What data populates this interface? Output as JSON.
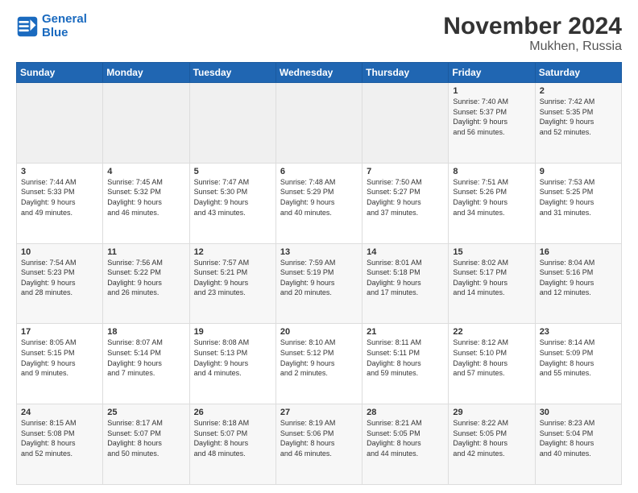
{
  "logo": {
    "line1": "General",
    "line2": "Blue"
  },
  "title": "November 2024",
  "subtitle": "Mukhen, Russia",
  "days_header": [
    "Sunday",
    "Monday",
    "Tuesday",
    "Wednesday",
    "Thursday",
    "Friday",
    "Saturday"
  ],
  "weeks": [
    [
      {
        "num": "",
        "info": ""
      },
      {
        "num": "",
        "info": ""
      },
      {
        "num": "",
        "info": ""
      },
      {
        "num": "",
        "info": ""
      },
      {
        "num": "",
        "info": ""
      },
      {
        "num": "1",
        "info": "Sunrise: 7:40 AM\nSunset: 5:37 PM\nDaylight: 9 hours\nand 56 minutes."
      },
      {
        "num": "2",
        "info": "Sunrise: 7:42 AM\nSunset: 5:35 PM\nDaylight: 9 hours\nand 52 minutes."
      }
    ],
    [
      {
        "num": "3",
        "info": "Sunrise: 7:44 AM\nSunset: 5:33 PM\nDaylight: 9 hours\nand 49 minutes."
      },
      {
        "num": "4",
        "info": "Sunrise: 7:45 AM\nSunset: 5:32 PM\nDaylight: 9 hours\nand 46 minutes."
      },
      {
        "num": "5",
        "info": "Sunrise: 7:47 AM\nSunset: 5:30 PM\nDaylight: 9 hours\nand 43 minutes."
      },
      {
        "num": "6",
        "info": "Sunrise: 7:48 AM\nSunset: 5:29 PM\nDaylight: 9 hours\nand 40 minutes."
      },
      {
        "num": "7",
        "info": "Sunrise: 7:50 AM\nSunset: 5:27 PM\nDaylight: 9 hours\nand 37 minutes."
      },
      {
        "num": "8",
        "info": "Sunrise: 7:51 AM\nSunset: 5:26 PM\nDaylight: 9 hours\nand 34 minutes."
      },
      {
        "num": "9",
        "info": "Sunrise: 7:53 AM\nSunset: 5:25 PM\nDaylight: 9 hours\nand 31 minutes."
      }
    ],
    [
      {
        "num": "10",
        "info": "Sunrise: 7:54 AM\nSunset: 5:23 PM\nDaylight: 9 hours\nand 28 minutes."
      },
      {
        "num": "11",
        "info": "Sunrise: 7:56 AM\nSunset: 5:22 PM\nDaylight: 9 hours\nand 26 minutes."
      },
      {
        "num": "12",
        "info": "Sunrise: 7:57 AM\nSunset: 5:21 PM\nDaylight: 9 hours\nand 23 minutes."
      },
      {
        "num": "13",
        "info": "Sunrise: 7:59 AM\nSunset: 5:19 PM\nDaylight: 9 hours\nand 20 minutes."
      },
      {
        "num": "14",
        "info": "Sunrise: 8:01 AM\nSunset: 5:18 PM\nDaylight: 9 hours\nand 17 minutes."
      },
      {
        "num": "15",
        "info": "Sunrise: 8:02 AM\nSunset: 5:17 PM\nDaylight: 9 hours\nand 14 minutes."
      },
      {
        "num": "16",
        "info": "Sunrise: 8:04 AM\nSunset: 5:16 PM\nDaylight: 9 hours\nand 12 minutes."
      }
    ],
    [
      {
        "num": "17",
        "info": "Sunrise: 8:05 AM\nSunset: 5:15 PM\nDaylight: 9 hours\nand 9 minutes."
      },
      {
        "num": "18",
        "info": "Sunrise: 8:07 AM\nSunset: 5:14 PM\nDaylight: 9 hours\nand 7 minutes."
      },
      {
        "num": "19",
        "info": "Sunrise: 8:08 AM\nSunset: 5:13 PM\nDaylight: 9 hours\nand 4 minutes."
      },
      {
        "num": "20",
        "info": "Sunrise: 8:10 AM\nSunset: 5:12 PM\nDaylight: 9 hours\nand 2 minutes."
      },
      {
        "num": "21",
        "info": "Sunrise: 8:11 AM\nSunset: 5:11 PM\nDaylight: 8 hours\nand 59 minutes."
      },
      {
        "num": "22",
        "info": "Sunrise: 8:12 AM\nSunset: 5:10 PM\nDaylight: 8 hours\nand 57 minutes."
      },
      {
        "num": "23",
        "info": "Sunrise: 8:14 AM\nSunset: 5:09 PM\nDaylight: 8 hours\nand 55 minutes."
      }
    ],
    [
      {
        "num": "24",
        "info": "Sunrise: 8:15 AM\nSunset: 5:08 PM\nDaylight: 8 hours\nand 52 minutes."
      },
      {
        "num": "25",
        "info": "Sunrise: 8:17 AM\nSunset: 5:07 PM\nDaylight: 8 hours\nand 50 minutes."
      },
      {
        "num": "26",
        "info": "Sunrise: 8:18 AM\nSunset: 5:07 PM\nDaylight: 8 hours\nand 48 minutes."
      },
      {
        "num": "27",
        "info": "Sunrise: 8:19 AM\nSunset: 5:06 PM\nDaylight: 8 hours\nand 46 minutes."
      },
      {
        "num": "28",
        "info": "Sunrise: 8:21 AM\nSunset: 5:05 PM\nDaylight: 8 hours\nand 44 minutes."
      },
      {
        "num": "29",
        "info": "Sunrise: 8:22 AM\nSunset: 5:05 PM\nDaylight: 8 hours\nand 42 minutes."
      },
      {
        "num": "30",
        "info": "Sunrise: 8:23 AM\nSunset: 5:04 PM\nDaylight: 8 hours\nand 40 minutes."
      }
    ]
  ]
}
